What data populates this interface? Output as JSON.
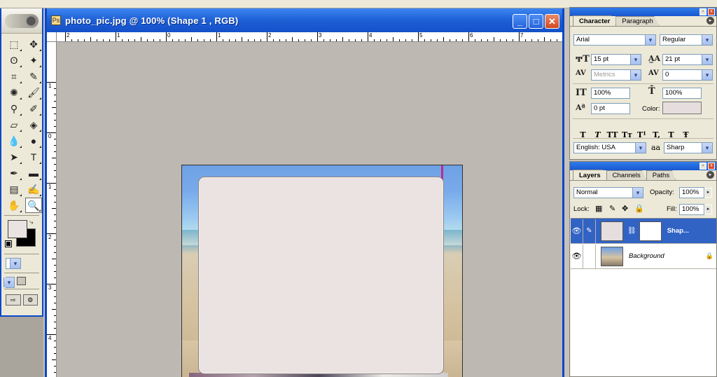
{
  "document": {
    "title": "photo_pic.jpg @ 100% (Shape 1 , RGB)",
    "zoom": "100%",
    "hruler_labels": [
      "2",
      "1",
      "0",
      "1",
      "2",
      "3",
      "4",
      "5",
      "6",
      "7"
    ],
    "vruler_labels": [
      "1",
      "0",
      "1",
      "2",
      "3",
      "4"
    ],
    "window_buttons": {
      "minimize": "_",
      "maximize": "□",
      "close": "✕"
    }
  },
  "toolbox": {
    "tools": [
      {
        "name": "marquee-icon",
        "glyph": "⬚"
      },
      {
        "name": "move-icon",
        "glyph": "✥"
      },
      {
        "name": "lasso-icon",
        "glyph": "ʘ"
      },
      {
        "name": "magic-wand-icon",
        "glyph": "✦"
      },
      {
        "name": "crop-icon",
        "glyph": "⌗"
      },
      {
        "name": "slice-icon",
        "glyph": "✎"
      },
      {
        "name": "healing-brush-icon",
        "glyph": "✺"
      },
      {
        "name": "brush-icon",
        "glyph": "🖌"
      },
      {
        "name": "clone-stamp-icon",
        "glyph": "⚲"
      },
      {
        "name": "history-brush-icon",
        "glyph": "✐"
      },
      {
        "name": "eraser-icon",
        "glyph": "▱"
      },
      {
        "name": "paint-bucket-icon",
        "glyph": "◈"
      },
      {
        "name": "blur-icon",
        "glyph": "💧"
      },
      {
        "name": "dodge-icon",
        "glyph": "●"
      },
      {
        "name": "path-selection-icon",
        "glyph": "➤"
      },
      {
        "name": "type-icon",
        "glyph": "T"
      },
      {
        "name": "pen-icon",
        "glyph": "✒"
      },
      {
        "name": "shape-icon",
        "glyph": "▬"
      },
      {
        "name": "notes-icon",
        "glyph": "▤"
      },
      {
        "name": "eyedropper-icon",
        "glyph": "✍"
      },
      {
        "name": "hand-icon",
        "glyph": "✋"
      },
      {
        "name": "zoom-icon",
        "glyph": "🔍"
      }
    ],
    "active_tool": "zoom-icon",
    "foreground_color": "#e9e3e2",
    "background_color": "#000000"
  },
  "character": {
    "tabs": [
      "Character",
      "Paragraph"
    ],
    "font_family": "Arial",
    "font_style": "Regular",
    "font_size": "15 pt",
    "leading": "21 pt",
    "kerning": "Metrics",
    "tracking": "0",
    "vertical_scale": "100%",
    "horizontal_scale": "100%",
    "baseline_shift": "0 pt",
    "color_label": "Color:",
    "color_value": "#e6dede",
    "style_buttons": [
      "T",
      "T",
      "TT",
      "Tт",
      "T¹",
      "T,",
      "T",
      "Ŧ"
    ],
    "language": "English: USA",
    "antialias_icon_label": "aa",
    "antialias": "Sharp"
  },
  "layers": {
    "tabs": [
      "Layers",
      "Channels",
      "Paths"
    ],
    "blend_mode": "Normal",
    "opacity_label": "Opacity:",
    "opacity": "100%",
    "lock_label": "Lock:",
    "fill_label": "Fill:",
    "fill": "100%",
    "items": [
      {
        "name": "Shap...",
        "active": true
      },
      {
        "name": "Background",
        "active": false
      }
    ]
  }
}
